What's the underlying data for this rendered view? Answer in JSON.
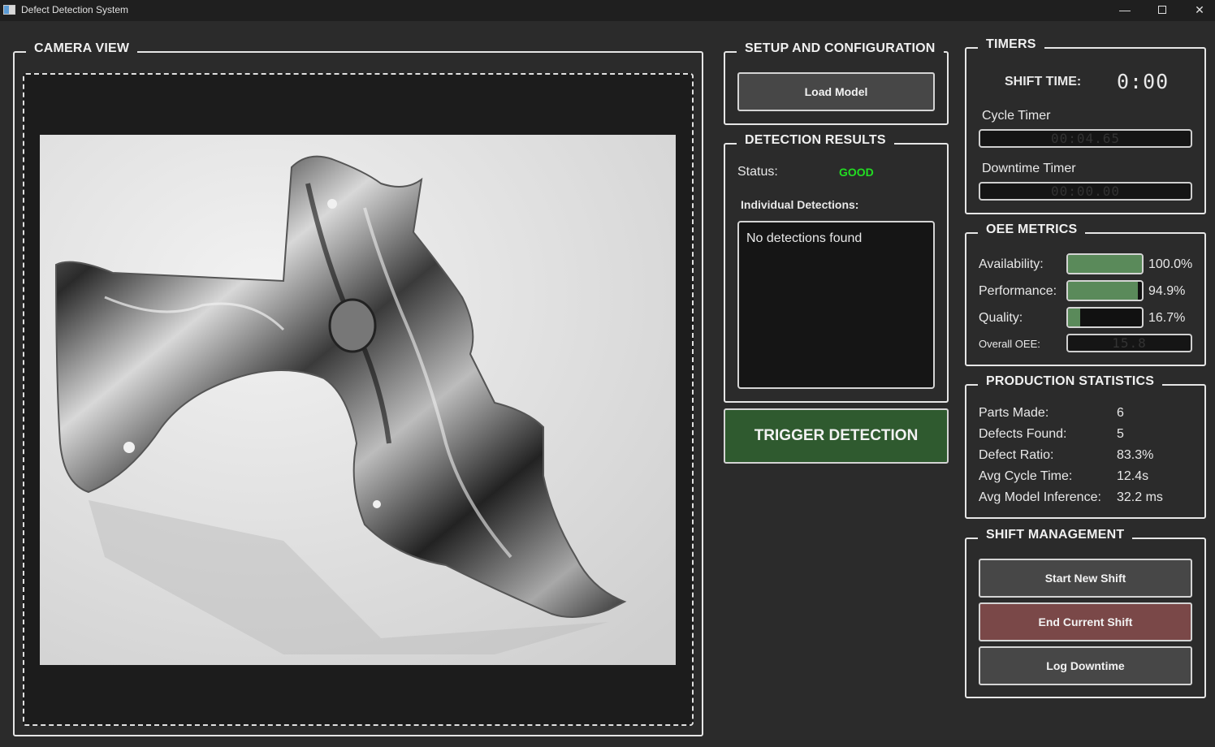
{
  "window": {
    "title": "Defect Detection System",
    "minimize": "—",
    "close": "✕"
  },
  "camera": {
    "title": "CAMERA VIEW"
  },
  "setup": {
    "title": "SETUP AND CONFIGURATION",
    "load_model": "Load Model"
  },
  "detection": {
    "title": "DETECTION RESULTS",
    "status_label": "Status:",
    "status_value": "GOOD",
    "status_color": "#22dd22",
    "individual_label": "Individual Detections:",
    "list_text": "No detections found"
  },
  "trigger": {
    "label": "TRIGGER DETECTION",
    "color": "#2f5a2f"
  },
  "timers": {
    "title": "TIMERS",
    "shift_label": "SHIFT TIME:",
    "shift_value": "0:00",
    "cycle_label": "Cycle Timer",
    "cycle_value": "00:04.65",
    "downtime_label": "Downtime Timer",
    "downtime_value": "00:00.00"
  },
  "oee": {
    "title": "OEE METRICS",
    "availability_label": "Availability:",
    "availability_text": "100.0%",
    "availability_fraction": 1.0,
    "performance_label": "Performance:",
    "performance_text": "94.9%",
    "performance_fraction": 0.949,
    "quality_label": "Quality:",
    "quality_text": "16.7%",
    "quality_fraction": 0.167,
    "overall_label": "Overall OEE:",
    "overall_value": "15.8",
    "bar_color": "#5a8a5a"
  },
  "production": {
    "title": "PRODUCTION STATISTICS",
    "rows": [
      {
        "label": "Parts Made:",
        "value": "6"
      },
      {
        "label": "Defects Found:",
        "value": "5"
      },
      {
        "label": "Defect Ratio:",
        "value": "83.3%"
      },
      {
        "label": "Avg Cycle Time:",
        "value": "12.4s"
      },
      {
        "label": "Avg Model Inference:",
        "value": "32.2 ms"
      }
    ]
  },
  "shift": {
    "title": "SHIFT MANAGEMENT",
    "start_label": "Start New Shift",
    "end_label": "End Current Shift",
    "end_color": "#7a4848",
    "log_label": "Log Downtime"
  }
}
